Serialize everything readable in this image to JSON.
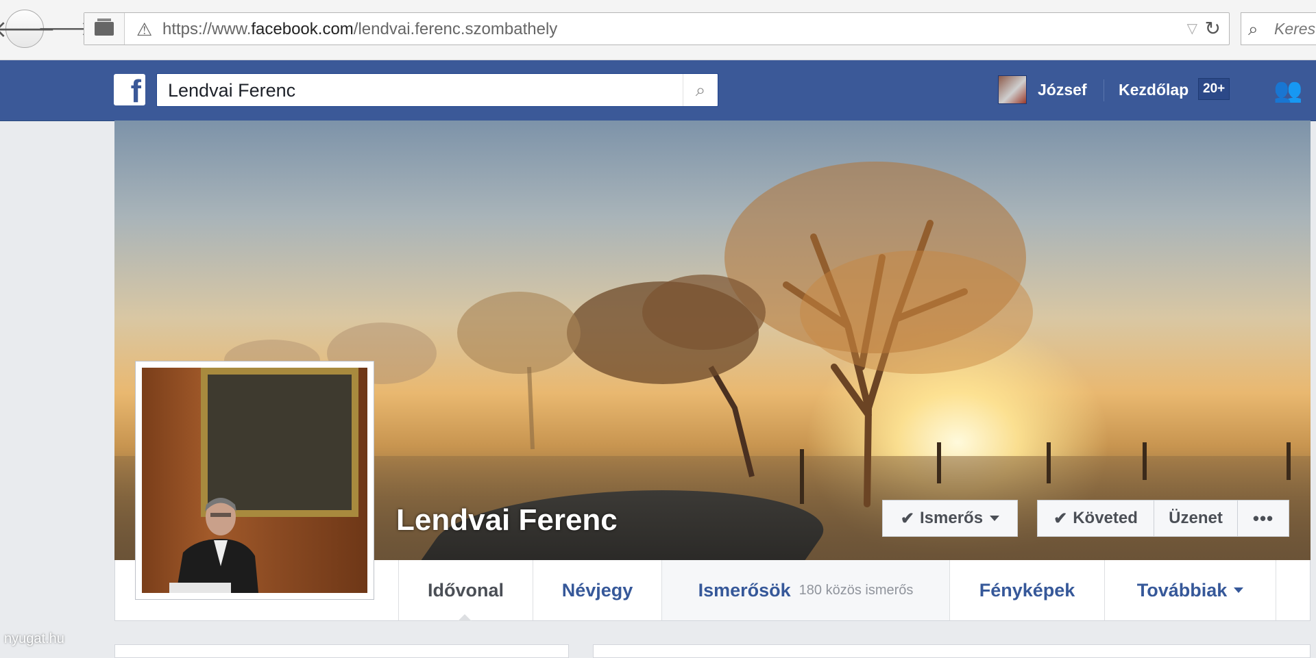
{
  "browser": {
    "url_prefix": "https://www.",
    "url_domain": "facebook.com",
    "url_path": "/lendvai.ferenc.szombathely",
    "search_placeholder": "Keres"
  },
  "fb_header": {
    "search_value": "Lendvai Ferenc",
    "user_name": "József",
    "home_label": "Kezdőlap",
    "home_count": "20+"
  },
  "profile": {
    "name": "Lendvai Ferenc",
    "actions": {
      "friend": "Ismerős",
      "following": "Követed",
      "message": "Üzenet",
      "more": "•••"
    },
    "tabs": [
      {
        "label": "Idővonal"
      },
      {
        "label": "Névjegy"
      },
      {
        "label": "Ismerősök",
        "sub": "180 közös ismerős"
      },
      {
        "label": "Fényképek"
      },
      {
        "label": "Továbbiak"
      }
    ]
  },
  "watermark": "nyugat.hu",
  "colors": {
    "fb_blue": "#3b5998",
    "link_blue": "#365899"
  }
}
